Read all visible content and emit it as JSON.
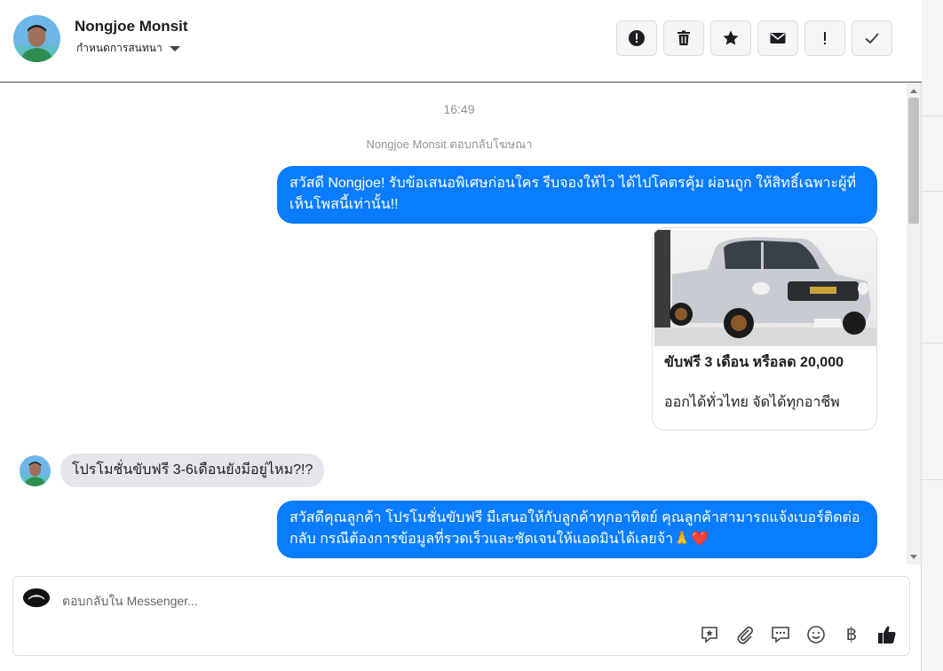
{
  "header": {
    "contact_name": "Nongjoe Monsit",
    "assign_label": "กำหนดการสนทนา",
    "actions": [
      {
        "name": "spam-icon"
      },
      {
        "name": "trash-icon"
      },
      {
        "name": "star-icon"
      },
      {
        "name": "mail-icon"
      },
      {
        "name": "exclamation-icon"
      },
      {
        "name": "check-icon"
      }
    ]
  },
  "conversation": {
    "timestamp": "16:49",
    "system_note": "Nongjoe Monsit ตอบกลับโฆษณา",
    "messages": [
      {
        "from": "page",
        "text": "สวัสดี Nongjoe! รับข้อเสนอพิเศษก่อนใคร รีบจองให้ไว ได้ไปโคตรคุ้ม ผ่อนถูก ให้สิทธิ์เฉพาะผู้ที่เห็นโพสนี้เท่านั้น!!"
      },
      {
        "from": "page",
        "type": "ad_card",
        "title": "ขับฟรี 3 เดือน หรือลด 20,000",
        "description": "ออกได้ทั่วไทย จัดได้ทุกอาชีพ"
      },
      {
        "from": "customer",
        "text": "โปรโมชั่นขับฟรี 3-6เดือนยังมีอยู่ไหม?!?"
      },
      {
        "from": "page",
        "text": "สวัสดีคุณลูกค้า โปรโมชั่นขับฟรี มีเสนอให้กับลูกค้าทุกอาทิตย์ คุณลูกค้าสามารถแจ้งเบอร์ติดต่อกลับ กรณีต้องการข้อมูลที่รวดเร็วและชัดเจนให้แอดมินได้เลยจ้า🙏❤️"
      }
    ]
  },
  "composer": {
    "placeholder": "ตอบกลับใน Messenger...",
    "tools": [
      "saved-reply-icon",
      "attachment-icon",
      "chat-icon",
      "emoji-icon",
      "baht-icon",
      "like-icon"
    ],
    "baht_symbol": "฿"
  },
  "colors": {
    "outgoing_bubble": "#0a7cff",
    "incoming_bubble": "#e4e6eb"
  }
}
